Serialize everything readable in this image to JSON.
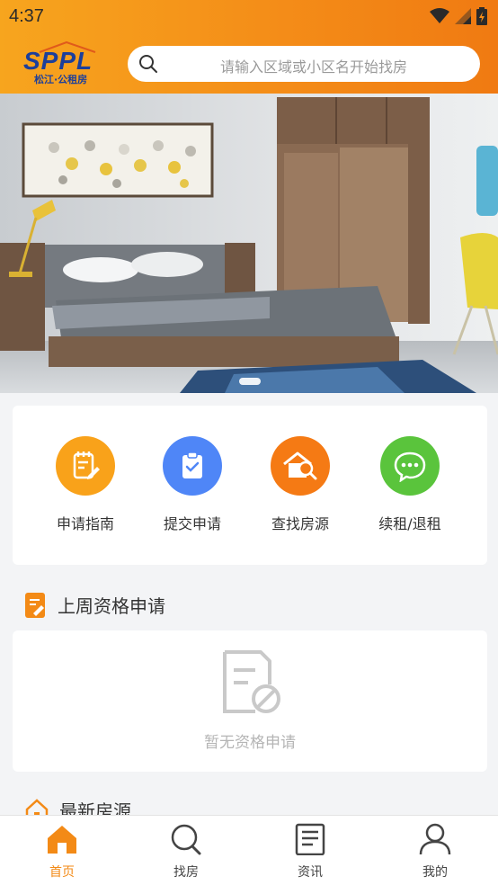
{
  "status_bar": {
    "time": "4:37"
  },
  "header": {
    "logo_text": "SPPL",
    "logo_subtitle": "松江·公租房",
    "search_placeholder": "请输入区域或小区名开始找房"
  },
  "banner": {
    "slide_count": 1,
    "active_slide": 1
  },
  "quick_menu": [
    {
      "label": "申请指南",
      "icon": "guide-icon",
      "color": "#f9a21a"
    },
    {
      "label": "提交申请",
      "icon": "clipboard-check-icon",
      "color": "#4f86f7"
    },
    {
      "label": "查找房源",
      "icon": "house-search-icon",
      "color": "#f57a14"
    },
    {
      "label": "续租/退租",
      "icon": "chat-icon",
      "color": "#5ac43c"
    }
  ],
  "last_week_section": {
    "title": "上周资格申请",
    "empty_text": "暂无资格申请"
  },
  "latest_section": {
    "title": "最新房源"
  },
  "tabbar": {
    "active": "首页",
    "items": [
      {
        "label": "首页",
        "icon": "home-icon"
      },
      {
        "label": "找房",
        "icon": "search-icon"
      },
      {
        "label": "资讯",
        "icon": "news-icon"
      },
      {
        "label": "我的",
        "icon": "user-icon"
      }
    ]
  },
  "colors": {
    "accent": "#f38a16",
    "header_start": "#f7a51e",
    "header_end": "#f07a12",
    "logo_blue": "#1d3f9a"
  }
}
